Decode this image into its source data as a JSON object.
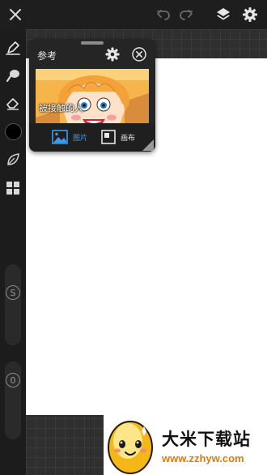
{
  "reference_panel": {
    "title": "参考",
    "image_caption": "被接触的人",
    "tabs": [
      {
        "label": "图片",
        "active": true
      },
      {
        "label": "画布",
        "active": false
      }
    ]
  },
  "left_toolbar": {
    "brush_size_label": "S",
    "opacity_label": "0",
    "current_color": "#000000"
  },
  "watermark": {
    "brand": "大米下载站",
    "url": "www.zzhyw.com"
  },
  "colors": {
    "accent": "#3a9bf0",
    "toolbar_bg": "#1c1c1c",
    "panel_bg": "#252525",
    "canvas": "#ffffff",
    "url_orange": "#e07b10"
  }
}
